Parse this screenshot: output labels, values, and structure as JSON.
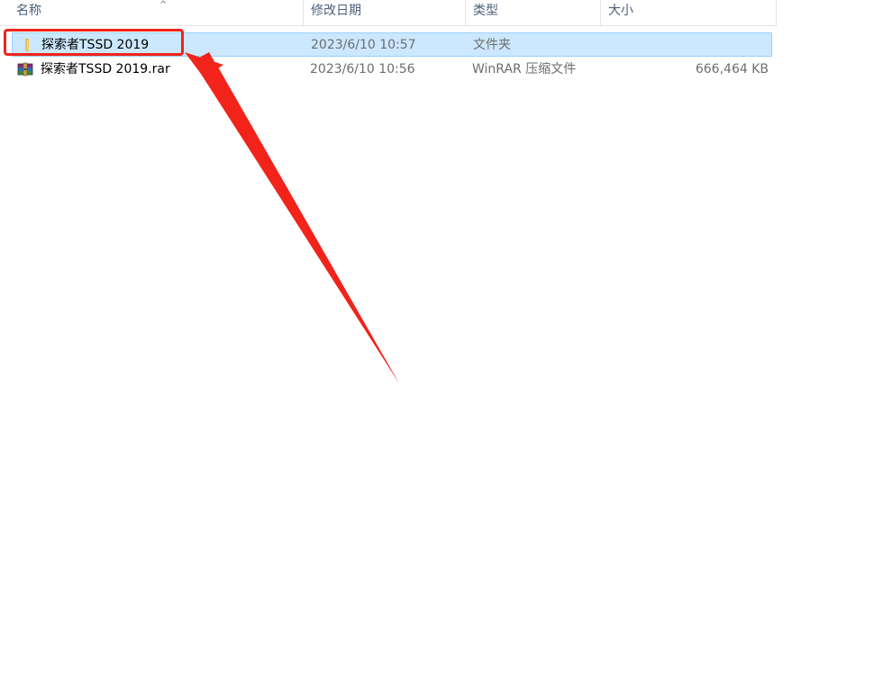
{
  "columns": {
    "name": "名称",
    "date": "修改日期",
    "type": "类型",
    "size": "大小",
    "sort_indicator": "^"
  },
  "files": [
    {
      "name": "探索者TSSD 2019",
      "date": "2023/6/10 10:57",
      "type": "文件夹",
      "size": "",
      "icon": "folder-icon",
      "selected": true
    },
    {
      "name": "探索者TSSD 2019.rar",
      "date": "2023/6/10 10:56",
      "type": "WinRAR 压缩文件",
      "size": "666,464 KB",
      "icon": "winrar-archive-icon",
      "selected": false
    }
  ],
  "colors": {
    "selection": "#cce8ff",
    "selection_border": "#99d1ff",
    "annotation": "#f2231a",
    "header_text": "#4c607a"
  }
}
